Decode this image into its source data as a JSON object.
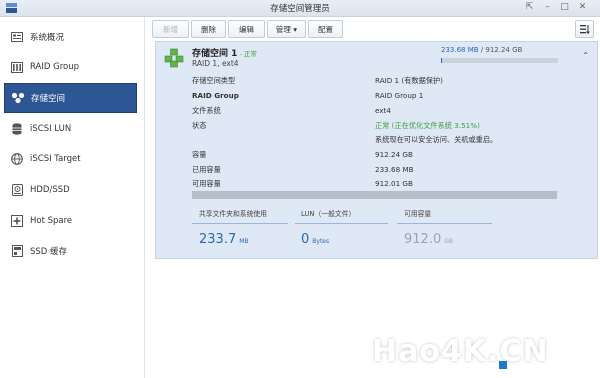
{
  "window": {
    "title": "存储空间管理员"
  },
  "sidebar": {
    "items": [
      {
        "label": "系统概况",
        "icon": "overview-icon"
      },
      {
        "label": "RAID Group",
        "icon": "raid-group-icon"
      },
      {
        "label": "存储空间",
        "icon": "storage-volume-icon",
        "active": true
      },
      {
        "label": "iSCSI LUN",
        "icon": "iscsi-lun-icon"
      },
      {
        "label": "iSCSI Target",
        "icon": "iscsi-target-icon"
      },
      {
        "label": "HDD/SSD",
        "icon": "hdd-icon"
      },
      {
        "label": "Hot Spare",
        "icon": "hot-spare-icon"
      },
      {
        "label": "SSD 缓存",
        "icon": "ssd-cache-icon"
      }
    ]
  },
  "toolbar": {
    "new_label": "新增",
    "delete_label": "删除",
    "edit_label": "编辑",
    "manage_label": "管理 ▾",
    "config_label": "配置"
  },
  "volume": {
    "name": "存储空间 1",
    "status_inline": " - 正常",
    "subtitle": "RAID 1, ext4",
    "used_text": "233.68 MB",
    "total_text": " / 912.24 GB",
    "used_fraction": 0.0003,
    "details": [
      {
        "label": "存储空间类型",
        "value": "RAID 1 (有数据保护)"
      },
      {
        "label": "RAID Group",
        "value": "RAID Group 1"
      },
      {
        "label": "文件系统",
        "value": "ext4"
      },
      {
        "label": "状态",
        "value": "正常 (正在优化文件系统 3.51%)"
      },
      {
        "label": "",
        "value": "系统现在可以安全访问、关机或重启。"
      },
      {
        "label": "容量",
        "value": "912.24 GB"
      },
      {
        "label": "已用容量",
        "value": "233.68 MB"
      },
      {
        "label": "可用容量",
        "value": "912.01 GB"
      }
    ],
    "stats": [
      {
        "label": "共享文件夹和系统使用",
        "value": "233.7",
        "unit": "MB"
      },
      {
        "label": "LUN（一般文件）",
        "value": "0",
        "unit": "Bytes"
      },
      {
        "label": "可用容量",
        "value": "912.0",
        "unit": "GB"
      }
    ]
  },
  "colors": {
    "accent": "#2c5694",
    "link_blue": "#2a66b8",
    "ok_green": "#3a9d3a",
    "panel_bg": "#dfe9f6"
  },
  "watermark": {
    "text": "Hao4K.CN"
  }
}
